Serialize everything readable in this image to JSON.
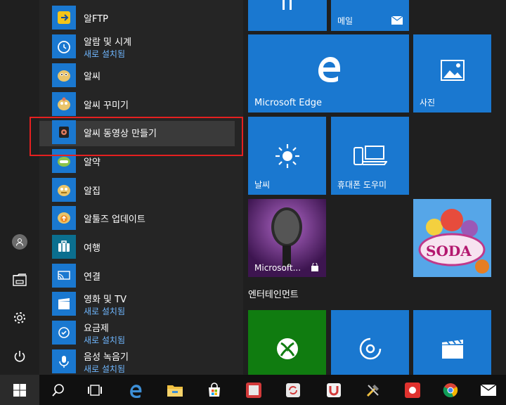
{
  "rail": {
    "user_icon": "user-icon",
    "explorer_icon": "file-explorer-icon",
    "settings_icon": "gear-icon",
    "power_icon": "power-icon"
  },
  "apps": [
    {
      "name": "알FTP",
      "sub": ""
    },
    {
      "name": "알람 및 시계",
      "sub": "새로 설치됨"
    },
    {
      "name": "알씨",
      "sub": ""
    },
    {
      "name": "알씨 꾸미기",
      "sub": ""
    },
    {
      "name": "알씨 동영상 만들기",
      "sub": ""
    },
    {
      "name": "알약",
      "sub": ""
    },
    {
      "name": "알집",
      "sub": ""
    },
    {
      "name": "알툴즈 업데이트",
      "sub": ""
    },
    {
      "name": "여행",
      "sub": ""
    },
    {
      "name": "연결",
      "sub": ""
    },
    {
      "name": "영화 및 TV",
      "sub": "새로 설치됨"
    },
    {
      "name": "요금제",
      "sub": "새로 설치됨"
    },
    {
      "name": "음성 녹음기",
      "sub": "새로 설치됨"
    }
  ],
  "tiles": {
    "mail": "메일",
    "edge": "Microsoft Edge",
    "photos": "사진",
    "weather": "날씨",
    "phone": "휴대폰 도우미",
    "music": "Microsoft...",
    "candy": "SODA",
    "group_title": "엔터테인먼트"
  },
  "colors": {
    "accent": "#1a78d0",
    "highlight": "#e52020",
    "link": "#6fb7ff"
  }
}
